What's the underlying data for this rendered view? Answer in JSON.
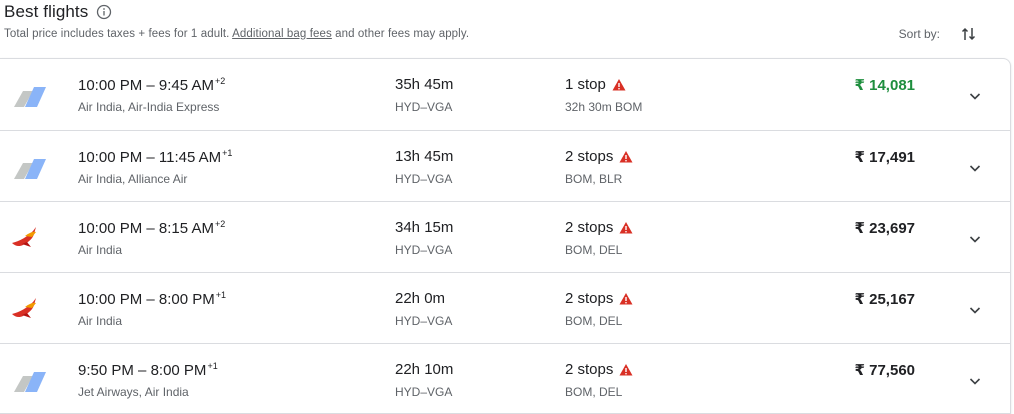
{
  "header": {
    "title": "Best flights",
    "info_icon": "info-icon",
    "subtitle_before": "Total price includes taxes + fees for 1 adult. ",
    "subtitle_link": "Additional bag fees",
    "subtitle_after": " and other fees may apply.",
    "sort_label": "Sort by:",
    "sort_icon": "sort-icon"
  },
  "colors": {
    "best_price": "#1e8e3e",
    "warning": "#d93025",
    "divider": "#dadce0"
  },
  "flights": [
    {
      "logo": "generic-airline-logo",
      "depart": "10:00 PM",
      "arrive": "9:45 AM",
      "day_offset": "+2",
      "airlines": "Air India, Air-India Express",
      "duration": "35h 45m",
      "route": "HYD–VGA",
      "stops": "1 stop",
      "stop_detail": "32h 30m BOM",
      "price": "₹ 14,081"
    },
    {
      "logo": "generic-airline-logo",
      "depart": "10:00 PM",
      "arrive": "11:45 AM",
      "day_offset": "+1",
      "airlines": "Air India, Alliance Air",
      "duration": "13h 45m",
      "route": "HYD–VGA",
      "stops": "2 stops",
      "stop_detail": "BOM, BLR",
      "price": "₹ 17,491"
    },
    {
      "logo": "air-india-logo",
      "depart": "10:00 PM",
      "arrive": "8:15 AM",
      "day_offset": "+2",
      "airlines": "Air India",
      "duration": "34h 15m",
      "route": "HYD–VGA",
      "stops": "2 stops",
      "stop_detail": "BOM, DEL",
      "price": "₹ 23,697"
    },
    {
      "logo": "air-india-logo",
      "depart": "10:00 PM",
      "arrive": "8:00 PM",
      "day_offset": "+1",
      "airlines": "Air India",
      "duration": "22h 0m",
      "route": "HYD–VGA",
      "stops": "2 stops",
      "stop_detail": "BOM, DEL",
      "price": "₹ 25,167"
    },
    {
      "logo": "generic-airline-logo",
      "depart": "9:50 PM",
      "arrive": "8:00 PM",
      "day_offset": "+1",
      "airlines": "Jet Airways, Air India",
      "duration": "22h 10m",
      "route": "HYD–VGA",
      "stops": "2 stops",
      "stop_detail": "BOM, DEL",
      "price": "₹ 77,560"
    }
  ]
}
